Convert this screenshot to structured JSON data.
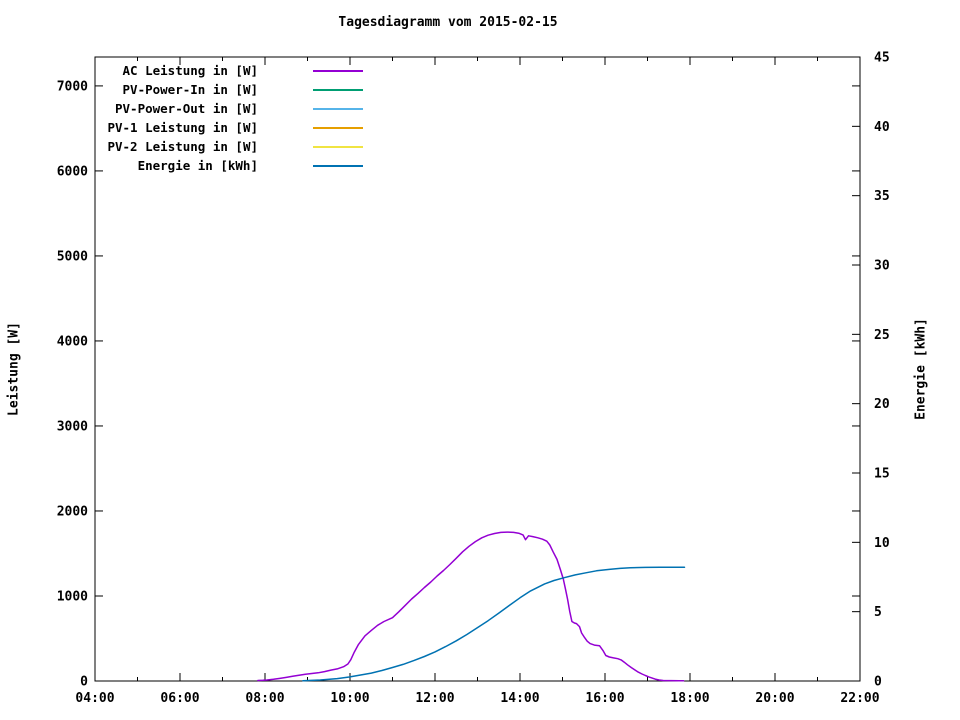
{
  "title": "Tagesdiagramm vom 2015-02-15",
  "chart_data": {
    "type": "line",
    "title": "Tagesdiagramm vom 2015-02-15",
    "background": "#ffffff",
    "border_color": "#000000",
    "grid": false,
    "legend_position": "top-left-inside",
    "x_axis": {
      "min_hour": 4,
      "max_hour": 22,
      "minor_tick_every_hours": 1,
      "major_ticks": [
        {
          "hour": 4,
          "label": "04:00"
        },
        {
          "hour": 6,
          "label": "06:00"
        },
        {
          "hour": 8,
          "label": "08:00"
        },
        {
          "hour": 10,
          "label": "10:00"
        },
        {
          "hour": 12,
          "label": "12:00"
        },
        {
          "hour": 14,
          "label": "14:00"
        },
        {
          "hour": 16,
          "label": "16:00"
        },
        {
          "hour": 18,
          "label": "18:00"
        },
        {
          "hour": 20,
          "label": "20:00"
        },
        {
          "hour": 22,
          "label": "22:00"
        }
      ]
    },
    "y_left_axis": {
      "label": "Leistung [W]",
      "min": 0,
      "max": 7340,
      "ticks": [
        0,
        1000,
        2000,
        3000,
        4000,
        5000,
        6000,
        7000
      ]
    },
    "y_right_axis": {
      "label": "Energie [kWh]",
      "min": 0,
      "max": 45,
      "ticks": [
        0,
        5,
        10,
        15,
        20,
        25,
        30,
        35,
        40,
        45
      ]
    },
    "legend": [
      {
        "label": "AC Leistung in [W]",
        "color": "#9400d3"
      },
      {
        "label": "PV-Power-In in [W]",
        "color": "#009e73"
      },
      {
        "label": "PV-Power-Out in [W]",
        "color": "#56b4e9"
      },
      {
        "label": "PV-1 Leistung in [W]",
        "color": "#e69f00"
      },
      {
        "label": "PV-2 Leistung in [W]",
        "color": "#f0e442"
      },
      {
        "label": "Energie in [kWh]",
        "color": "#0072b2"
      }
    ],
    "series": [
      {
        "name": "AC Leistung in [W]",
        "axis": "left",
        "unit": "W",
        "color": "#9400d3",
        "points": [
          [
            7.83,
            6
          ],
          [
            7.95,
            8
          ],
          [
            8.05,
            12
          ],
          [
            8.2,
            20
          ],
          [
            8.35,
            30
          ],
          [
            8.5,
            42
          ],
          [
            8.65,
            55
          ],
          [
            8.8,
            68
          ],
          [
            8.95,
            80
          ],
          [
            9.1,
            88
          ],
          [
            9.25,
            97
          ],
          [
            9.4,
            110
          ],
          [
            9.55,
            128
          ],
          [
            9.7,
            142
          ],
          [
            9.85,
            168
          ],
          [
            9.95,
            200
          ],
          [
            10.02,
            250
          ],
          [
            10.1,
            340
          ],
          [
            10.2,
            430
          ],
          [
            10.35,
            530
          ],
          [
            10.5,
            595
          ],
          [
            10.65,
            655
          ],
          [
            10.8,
            700
          ],
          [
            11.0,
            745
          ],
          [
            11.15,
            815
          ],
          [
            11.3,
            890
          ],
          [
            11.45,
            965
          ],
          [
            11.6,
            1030
          ],
          [
            11.75,
            1100
          ],
          [
            11.9,
            1165
          ],
          [
            12.05,
            1235
          ],
          [
            12.2,
            1300
          ],
          [
            12.35,
            1370
          ],
          [
            12.5,
            1445
          ],
          [
            12.65,
            1520
          ],
          [
            12.8,
            1585
          ],
          [
            12.95,
            1640
          ],
          [
            13.1,
            1685
          ],
          [
            13.25,
            1715
          ],
          [
            13.4,
            1735
          ],
          [
            13.55,
            1748
          ],
          [
            13.7,
            1752
          ],
          [
            13.85,
            1748
          ],
          [
            13.97,
            1738
          ],
          [
            14.07,
            1718
          ],
          [
            14.13,
            1662
          ],
          [
            14.2,
            1708
          ],
          [
            14.3,
            1698
          ],
          [
            14.42,
            1685
          ],
          [
            14.53,
            1668
          ],
          [
            14.63,
            1645
          ],
          [
            14.7,
            1600
          ],
          [
            14.78,
            1520
          ],
          [
            14.87,
            1430
          ],
          [
            14.95,
            1310
          ],
          [
            15.02,
            1200
          ],
          [
            15.07,
            1080
          ],
          [
            15.12,
            960
          ],
          [
            15.17,
            820
          ],
          [
            15.22,
            700
          ],
          [
            15.28,
            682
          ],
          [
            15.33,
            675
          ],
          [
            15.4,
            640
          ],
          [
            15.45,
            565
          ],
          [
            15.52,
            510
          ],
          [
            15.58,
            468
          ],
          [
            15.65,
            440
          ],
          [
            15.75,
            422
          ],
          [
            15.87,
            415
          ],
          [
            15.95,
            360
          ],
          [
            16.02,
            300
          ],
          [
            16.1,
            282
          ],
          [
            16.2,
            272
          ],
          [
            16.3,
            262
          ],
          [
            16.38,
            248
          ],
          [
            16.45,
            222
          ],
          [
            16.53,
            190
          ],
          [
            16.62,
            158
          ],
          [
            16.7,
            130
          ],
          [
            16.78,
            105
          ],
          [
            16.87,
            82
          ],
          [
            16.95,
            65
          ],
          [
            17.03,
            48
          ],
          [
            17.1,
            36
          ],
          [
            17.18,
            22
          ],
          [
            17.27,
            12
          ],
          [
            17.37,
            6
          ],
          [
            17.55,
            5
          ],
          [
            17.75,
            4
          ],
          [
            17.85,
            4
          ]
        ]
      },
      {
        "name": "Energie in [kWh]",
        "axis": "right",
        "unit": "kWh",
        "color": "#0072b2",
        "points": [
          [
            8.89,
            0.02
          ],
          [
            9.3,
            0.07
          ],
          [
            9.7,
            0.17
          ],
          [
            9.98,
            0.29
          ],
          [
            10.25,
            0.43
          ],
          [
            10.5,
            0.57
          ],
          [
            10.75,
            0.76
          ],
          [
            11.0,
            0.97
          ],
          [
            11.25,
            1.2
          ],
          [
            11.5,
            1.47
          ],
          [
            11.75,
            1.77
          ],
          [
            12.0,
            2.1
          ],
          [
            12.25,
            2.48
          ],
          [
            12.5,
            2.9
          ],
          [
            12.75,
            3.35
          ],
          [
            13.0,
            3.85
          ],
          [
            13.25,
            4.35
          ],
          [
            13.5,
            4.9
          ],
          [
            13.75,
            5.45
          ],
          [
            14.0,
            6.0
          ],
          [
            14.25,
            6.5
          ],
          [
            14.58,
            7.0
          ],
          [
            14.8,
            7.25
          ],
          [
            15.04,
            7.45
          ],
          [
            15.3,
            7.65
          ],
          [
            15.55,
            7.8
          ],
          [
            15.8,
            7.95
          ],
          [
            16.1,
            8.05
          ],
          [
            16.35,
            8.12
          ],
          [
            16.6,
            8.16
          ],
          [
            16.95,
            8.19
          ],
          [
            17.3,
            8.2
          ],
          [
            17.6,
            8.2
          ],
          [
            17.87,
            8.2
          ]
        ]
      }
    ]
  }
}
